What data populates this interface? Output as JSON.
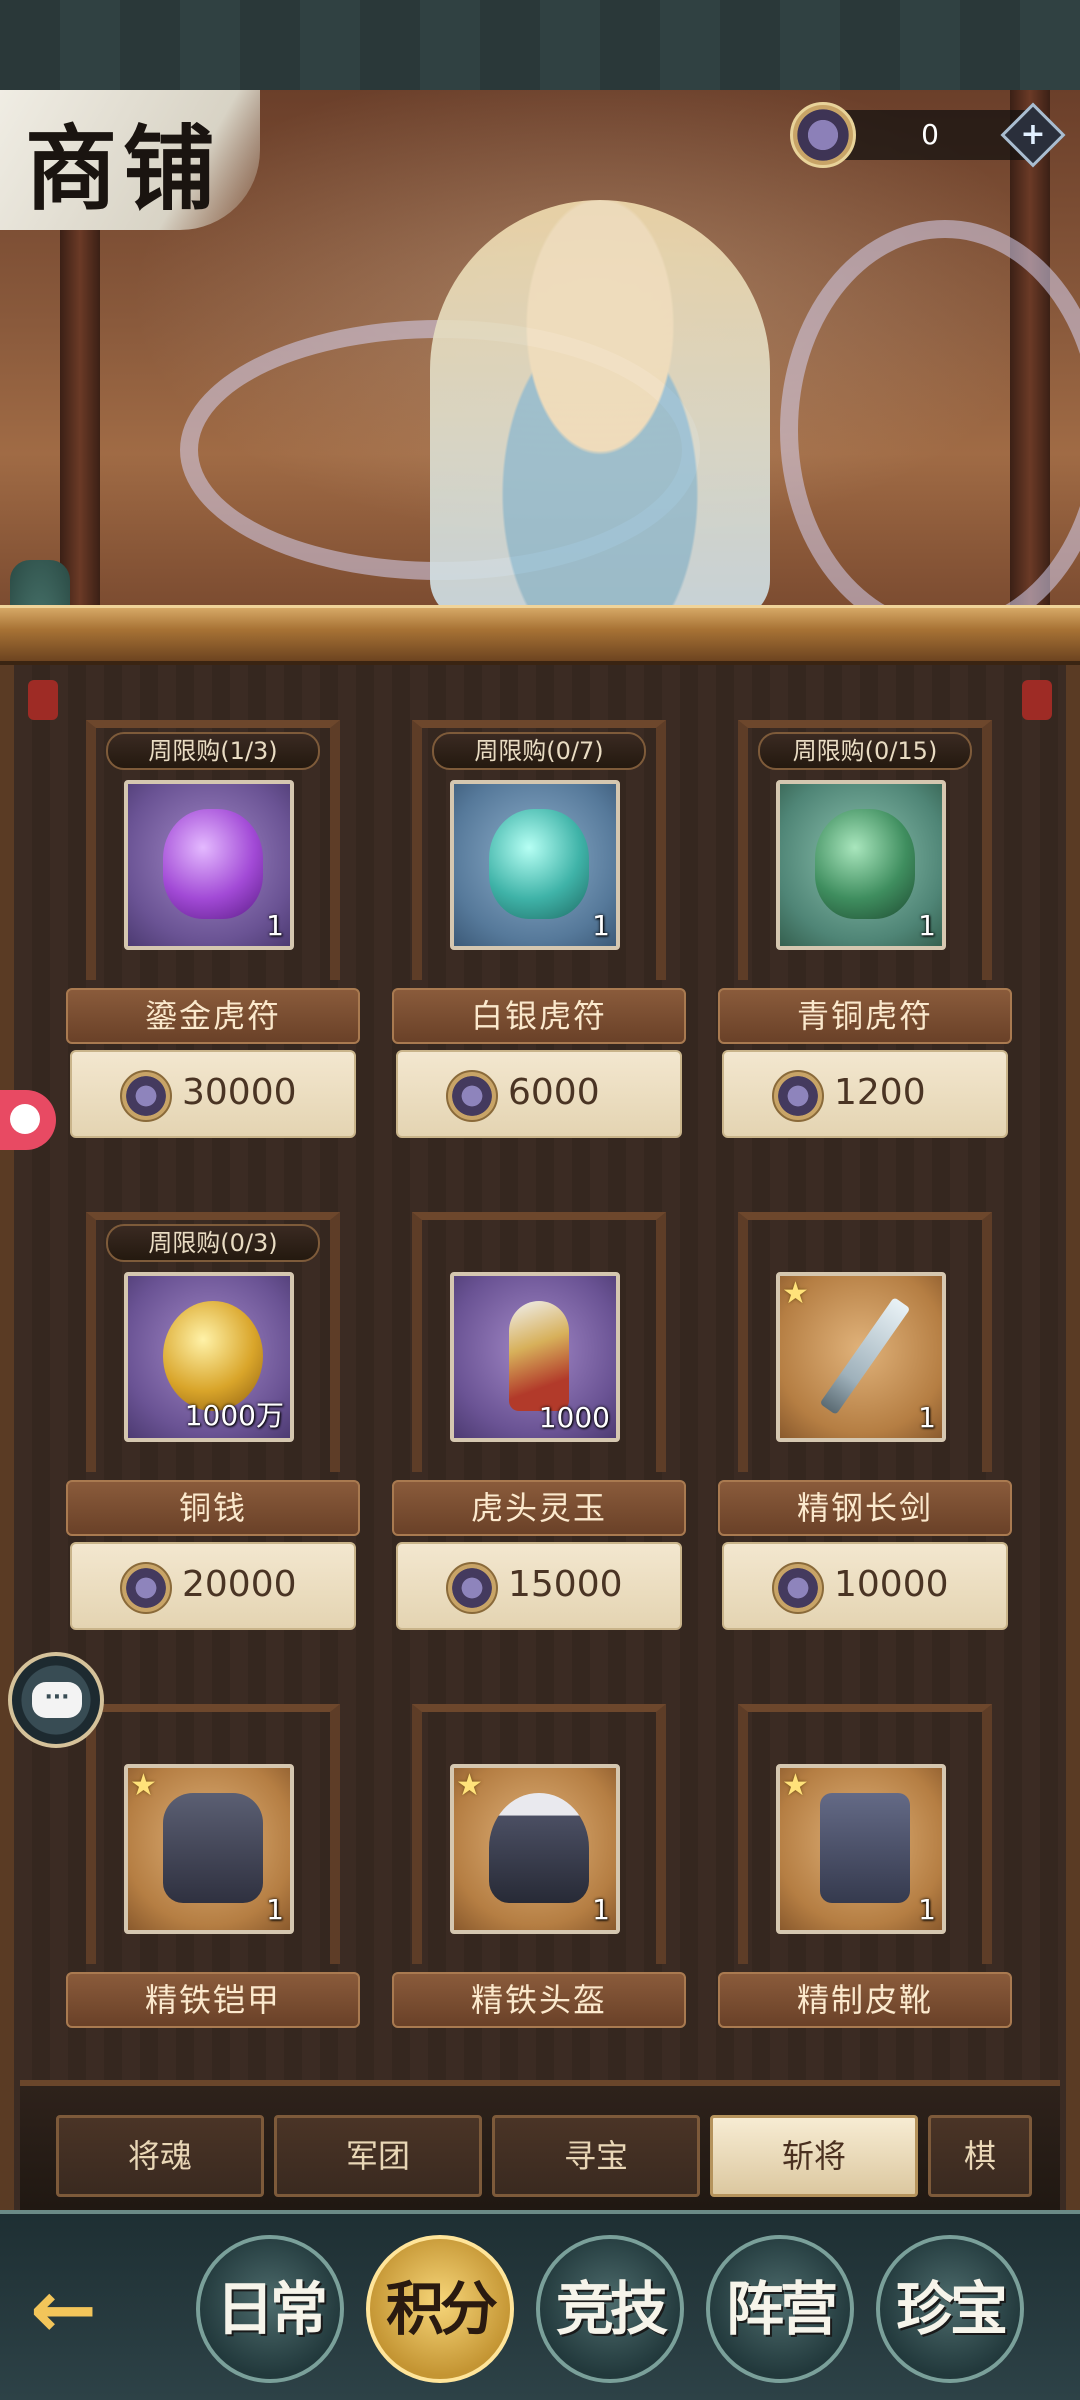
{
  "header": {
    "title": "商铺",
    "currency": {
      "value": "0",
      "plus_label": "+"
    }
  },
  "items": [
    {
      "name": "鎏金虎符",
      "limit": "周限购(1/3)",
      "qty": "1",
      "price": "30000",
      "rarity": "purple",
      "icon": "gilded-tiger-tally-icon"
    },
    {
      "name": "白银虎符",
      "limit": "周限购(0/7)",
      "qty": "1",
      "price": "6000",
      "rarity": "blue",
      "icon": "silver-tiger-tally-icon"
    },
    {
      "name": "青铜虎符",
      "limit": "周限购(0/15)",
      "qty": "1",
      "price": "1200",
      "rarity": "green",
      "icon": "bronze-tiger-tally-icon"
    },
    {
      "name": "铜钱",
      "limit": "周限购(0/3)",
      "qty": "1000万",
      "price": "20000",
      "rarity": "purple",
      "icon": "copper-coins-icon"
    },
    {
      "name": "虎头灵玉",
      "limit": "",
      "qty": "1000",
      "price": "15000",
      "rarity": "purple",
      "icon": "tiger-jade-icon"
    },
    {
      "name": "精钢长剑",
      "limit": "",
      "qty": "1",
      "price": "10000",
      "rarity": "orange",
      "icon": "steel-sword-icon",
      "star": true
    },
    {
      "name": "精铁铠甲",
      "limit": "",
      "qty": "1",
      "price": "",
      "rarity": "orange",
      "icon": "iron-armor-icon",
      "star": true
    },
    {
      "name": "精铁头盔",
      "limit": "",
      "qty": "1",
      "price": "",
      "rarity": "orange",
      "icon": "iron-helmet-icon",
      "star": true
    },
    {
      "name": "精制皮靴",
      "limit": "",
      "qty": "1",
      "price": "",
      "rarity": "orange",
      "icon": "leather-boots-icon",
      "star": true
    }
  ],
  "tabs": [
    "将魂",
    "军团",
    "寻宝",
    "斩将",
    "棋"
  ],
  "active_tab": "斩将",
  "bottom_nav": {
    "back_label": "←",
    "items": [
      "日常",
      "积分",
      "竞技",
      "阵营",
      "珍宝"
    ],
    "active": "积分"
  },
  "floating": {
    "chat_label": "···"
  },
  "colors": {
    "accent": "#c49533",
    "panel": "#3b2b23",
    "price_text": "#4a3424"
  }
}
